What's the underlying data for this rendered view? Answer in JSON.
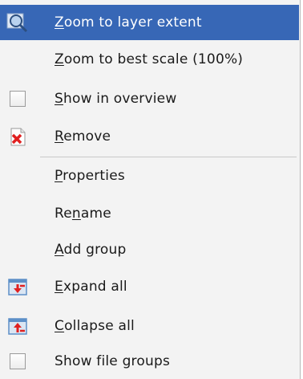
{
  "menu": {
    "items": [
      {
        "pre": "",
        "mn": "Z",
        "post": "oom to layer extent",
        "icon": "zoom-layer-icon",
        "highlighted": true
      },
      {
        "pre": "",
        "mn": "Z",
        "post": "oom to best scale (100%)",
        "icon": "",
        "highlighted": false
      },
      {
        "pre": "",
        "mn": "S",
        "post": "how in overview",
        "icon": "checkbox-unchecked",
        "highlighted": false
      },
      {
        "pre": "",
        "mn": "R",
        "post": "emove",
        "icon": "remove-icon",
        "highlighted": false
      },
      {
        "pre": "",
        "mn": "P",
        "post": "roperties",
        "icon": "",
        "highlighted": false
      },
      {
        "pre": "Re",
        "mn": "n",
        "post": "ame",
        "icon": "",
        "highlighted": false
      },
      {
        "pre": "",
        "mn": "A",
        "post": "dd group",
        "icon": "",
        "highlighted": false
      },
      {
        "pre": "",
        "mn": "E",
        "post": "xpand all",
        "icon": "expand-all-icon",
        "highlighted": false
      },
      {
        "pre": "",
        "mn": "C",
        "post": "ollapse all",
        "icon": "collapse-all-icon",
        "highlighted": false
      },
      {
        "pre": "",
        "mn": "",
        "post": "Show file groups",
        "icon": "checkbox-unchecked",
        "highlighted": false
      }
    ]
  },
  "colors": {
    "highlight": "#3767b6",
    "menu_background": "#f3f3f3",
    "remove_red": "#e02020"
  }
}
